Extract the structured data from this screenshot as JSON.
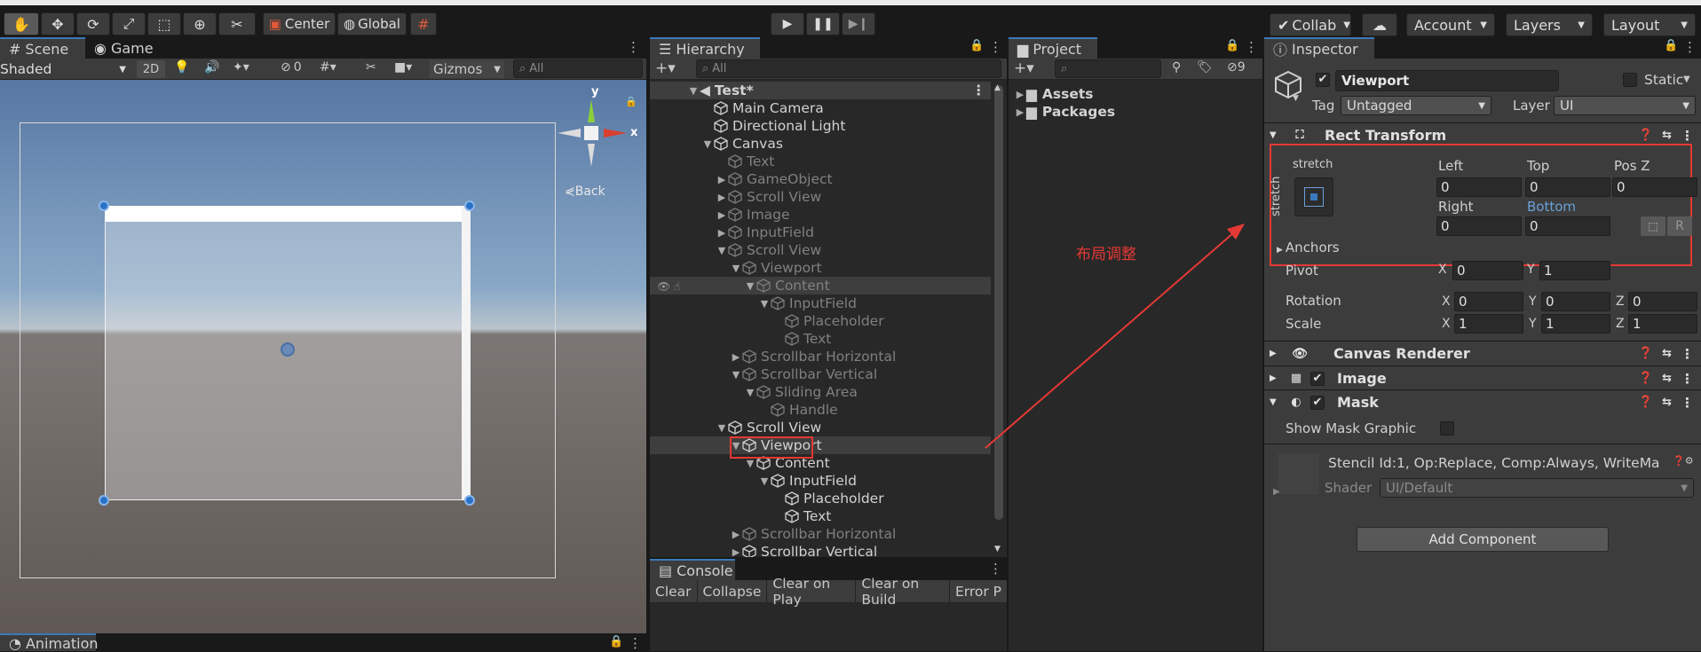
{
  "toolbar": {
    "pivot_label": "Center",
    "space_label": "Global",
    "collab_label": "Collab",
    "account_label": "Account",
    "layers_label": "Layers",
    "layout_label": "Layout"
  },
  "scene": {
    "tab_scene": "Scene",
    "tab_game": "Game",
    "draw_mode": "Shaded",
    "btn_2d": "2D",
    "hidden_count": "0",
    "gizmos_label": "Gizmos",
    "search_placeholder": "All",
    "axis_y": "y",
    "axis_x": "x",
    "back_label": "Back"
  },
  "animation": {
    "tab_label": "Animation"
  },
  "hierarchy": {
    "tab_label": "Hierarchy",
    "search_placeholder": "All",
    "scene_name": "Test*",
    "items": [
      "Main Camera",
      "Directional Light",
      "Canvas",
      "Text",
      "GameObject",
      "Scroll View",
      "Image",
      "InputField",
      "Scroll View",
      "Viewport",
      "Content",
      "InputField",
      "Placeholder",
      "Text",
      "Scrollbar Horizontal",
      "Scrollbar Vertical",
      "Sliding Area",
      "Handle",
      "Scroll View",
      "Viewport",
      "Content",
      "InputField",
      "Placeholder",
      "Text",
      "Scrollbar Horizontal",
      "Scrollbar Vertical"
    ]
  },
  "console": {
    "tab_label": "Console",
    "buttons": [
      "Clear",
      "Collapse",
      "Clear on Play",
      "Clear on Build",
      "Error P"
    ]
  },
  "project": {
    "tab_label": "Project",
    "hidden_count": "9",
    "folders": [
      "Assets",
      "Packages"
    ]
  },
  "inspector": {
    "tab_label": "Inspector",
    "object_name": "Viewport",
    "static_label": "Static",
    "tag_label": "Tag",
    "tag_value": "Untagged",
    "layer_label": "Layer",
    "layer_value": "UI",
    "rect_transform": {
      "title": "Rect Transform",
      "preset_h": "stretch",
      "preset_v": "stretch",
      "left_label": "Left",
      "left": "0",
      "top_label": "Top",
      "top": "0",
      "posz_label": "Pos Z",
      "posz": "0",
      "right_label": "Right",
      "right": "0",
      "bottom_label": "Bottom",
      "bottom": "0",
      "anchors_label": "Anchors",
      "pivot_label": "Pivot",
      "pivot_x": "0",
      "pivot_y": "1",
      "rotation_label": "Rotation",
      "rot_x": "0",
      "rot_y": "0",
      "rot_z": "0",
      "scale_label": "Scale",
      "scale_x": "1",
      "scale_y": "1",
      "scale_z": "1",
      "r_button": "R",
      "x": "X",
      "y": "Y",
      "z": "Z"
    },
    "canvas_renderer": "Canvas Renderer",
    "image": "Image",
    "mask": "Mask",
    "show_mask_graphic": "Show Mask Graphic",
    "material_info": "Stencil Id:1, Op:Replace, Comp:Always, WriteMa",
    "shader_label": "Shader",
    "shader_value": "UI/Default",
    "add_component": "Add Component"
  },
  "annotation": {
    "text": "布局调整",
    "color": "#e53935"
  }
}
